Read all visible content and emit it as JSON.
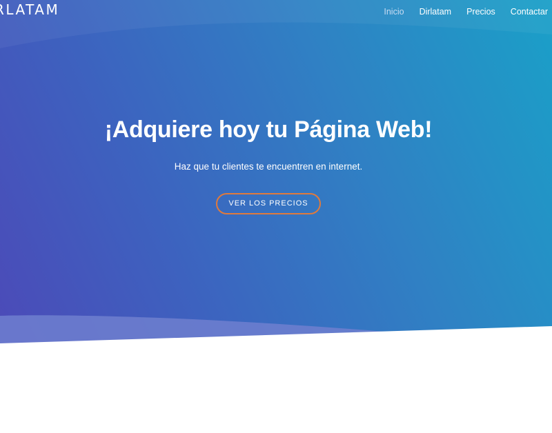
{
  "header": {
    "logo_text": "RLATAM",
    "nav": [
      {
        "label": "Inicio",
        "active": true
      },
      {
        "label": "Dirlatam",
        "active": false
      },
      {
        "label": "Precios",
        "active": false
      },
      {
        "label": "Contactar",
        "active": false
      }
    ]
  },
  "hero": {
    "headline": "¡Adquiere hoy tu Página Web!",
    "subtitle": "Haz que tu clientes te encuentren en internet.",
    "cta_label": "VER LOS PRECIOS"
  },
  "colors": {
    "gradient_start": "#4c4ab8",
    "gradient_end": "#1aa0c8",
    "cta_border": "#e07a3c",
    "text": "#ffffff",
    "active_nav": "#c9dcf2"
  }
}
